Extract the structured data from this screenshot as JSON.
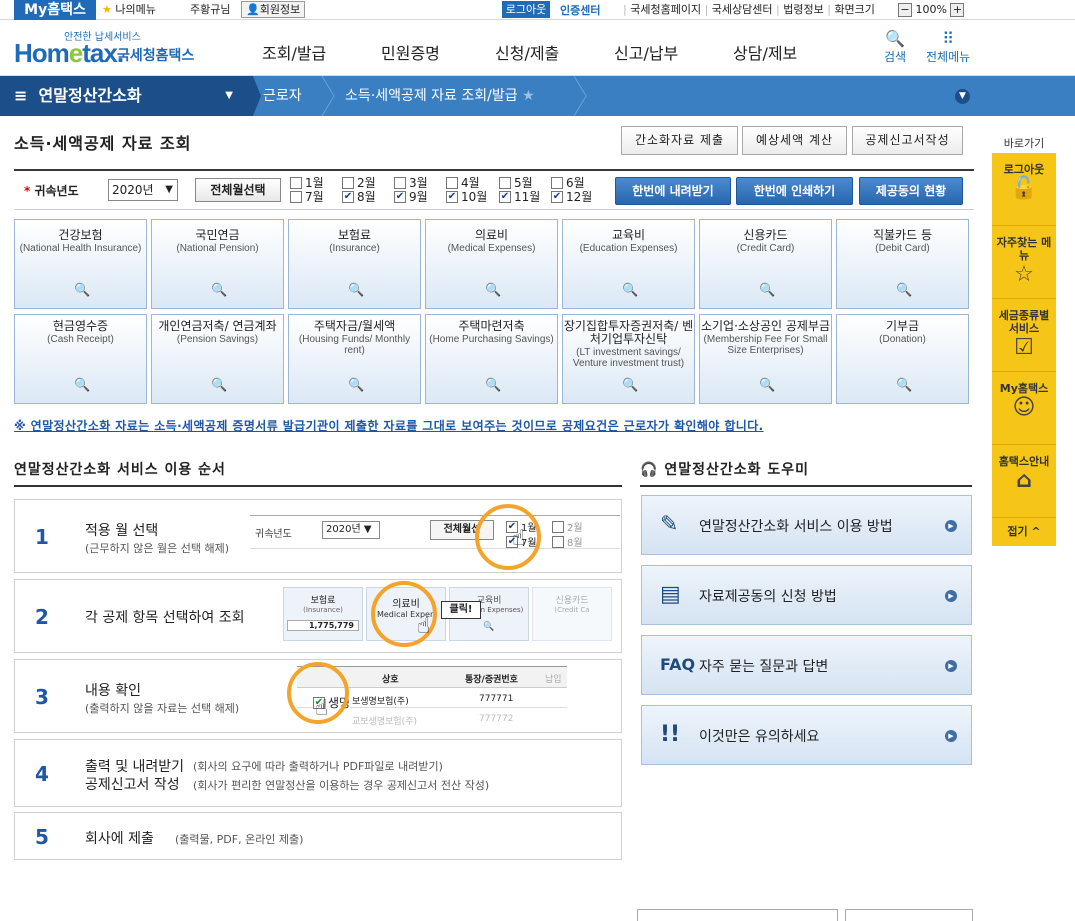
{
  "topbar": {
    "my_home": "My홈택스",
    "my_menu": "나의메뉴",
    "user_name": "주황규님",
    "member_info": "회원정보",
    "logout": "로그아웃",
    "cert_center": "인증센터",
    "links": [
      "국세청홈페이지",
      "국세상담센터",
      "법령정보",
      "화면크기"
    ],
    "zoom_minus": "−",
    "zoom": "100%",
    "zoom_plus": "+"
  },
  "header": {
    "logo_sub": "안전한 납세서비스",
    "logo_word_a": "Hom",
    "logo_word_e": "e",
    "logo_word_b": "tax.",
    "logo_kor": "국세청홈택스",
    "gnb": [
      "조회/발급",
      "민원증명",
      "신청/제출",
      "신고/납부",
      "상담/제보"
    ],
    "search": "검색",
    "all_menu": "전체메뉴"
  },
  "nav": {
    "main": "연말정산간소화",
    "crumb1": "근로자",
    "crumb2": "소득·세액공제 자료 조회/발급"
  },
  "page": {
    "title": "소득·세액공제 자료 조회",
    "top_buttons": [
      "간소화자료 제출",
      "예상세액 계산",
      "공제신고서작성"
    ]
  },
  "filter": {
    "label": "귀속년도",
    "year": "2020년",
    "select_all": "전체월선택",
    "months": [
      {
        "label": "1월",
        "checked": false
      },
      {
        "label": "2월",
        "checked": false
      },
      {
        "label": "3월",
        "checked": false
      },
      {
        "label": "4월",
        "checked": false
      },
      {
        "label": "5월",
        "checked": false
      },
      {
        "label": "6월",
        "checked": false
      },
      {
        "label": "7월",
        "checked": false
      },
      {
        "label": "8월",
        "checked": true
      },
      {
        "label": "9월",
        "checked": true
      },
      {
        "label": "10월",
        "checked": true
      },
      {
        "label": "11월",
        "checked": true
      },
      {
        "label": "12월",
        "checked": true
      }
    ],
    "download_all": "한번에 내려받기",
    "print_all": "한번에 인쇄하기",
    "provide_status": "제공동의 현황"
  },
  "tiles": [
    {
      "k": "건강보험",
      "e": "(National Health Insurance)"
    },
    {
      "k": "국민연금",
      "e": "(National Pension)"
    },
    {
      "k": "보험료",
      "e": "(Insurance)"
    },
    {
      "k": "의료비",
      "e": "(Medical Expenses)"
    },
    {
      "k": "교육비",
      "e": "(Education Expenses)"
    },
    {
      "k": "신용카드",
      "e": "(Credit Card)"
    },
    {
      "k": "직불카드 등",
      "e": "(Debit Card)"
    },
    {
      "k": "현금영수증",
      "e": "(Cash Receipt)"
    },
    {
      "k": "개인연금저축/ 연금계좌",
      "e": "(Pension Savings)"
    },
    {
      "k": "주택자금/월세액",
      "e": "(Housing Funds/ Monthly rent)"
    },
    {
      "k": "주택마련저축",
      "e": "(Home Purchasing Savings)"
    },
    {
      "k": "장기집합투자증권저축/ 벤처기업투자신탁",
      "e": "(LT investment savings/ Venture investment trust)"
    },
    {
      "k": "소기업·소상공인 공제부금",
      "e": "(Membership Fee For Small Size Enterprises)"
    },
    {
      "k": "기부금",
      "e": "(Donation)"
    }
  ],
  "notice": "※ 연말정산간소화 자료는 소득·세액공제 증명서류 발급기관이 제출한 자료를 그대로 보여주는 것이므로 공제요건은 근로자가 확인해야 합니다.",
  "steps_title": "연말정산간소화 서비스 이용 순서",
  "steps": [
    {
      "n": "1",
      "t": "적용 월 선택",
      "d": "(근무하지 않은 월은 선택 해제)"
    },
    {
      "n": "2",
      "t": "각 공제 항목 선택하여 조회",
      "d": ""
    },
    {
      "n": "3",
      "t": "내용 확인",
      "d": "(출력하지 않을 자료는 선택 해제)"
    },
    {
      "n": "4",
      "t": "출력 및 내려받기",
      "t2": "공제신고서 작성",
      "d": "(회사의 요구에 따라 출력하거나 PDF파일로 내려받기)",
      "d2": "(회사가 편리한 연말정산을 이용하는 경우 공제신고서 전산 작성)"
    },
    {
      "n": "5",
      "t": "회사에 제출",
      "d": "(출력물, PDF, 온라인 제출)"
    }
  ],
  "illus": {
    "s1_label": "귀속년도",
    "s1_year": "2020년",
    "s1_btn": "전체월선",
    "s1_m1": "1월",
    "s1_m2": "2월",
    "s1_m7": "7월",
    "s1_m8": "8월",
    "s2_a": "보험료",
    "s2_a_e": "(Insurance)",
    "s2_val": "1,775,779",
    "s2_b": "의료비",
    "s2_b_e": "Medical Expen",
    "s2_click": "클릭!",
    "s2_c": "교육비",
    "s2_c_e": "ducation Expenses)",
    "s2_d": "신용카드",
    "s2_d_e": "(Credit Ca",
    "s3_h1": "상호",
    "s3_h2": "통장/증권번호",
    "s3_h3": "납입",
    "s3_name": "생명",
    "s3_co": "보생명보험(주)",
    "s3_num": "777771",
    "s3_co2": "교보생명보험(주)",
    "s3_num2": "777772"
  },
  "help_title": "연말정산간소화 도우미",
  "help": [
    {
      "icon": "doc-pen-icon",
      "glyph": "✎",
      "t": "연말정산간소화 서비스 이용 방법"
    },
    {
      "icon": "doc-icon",
      "glyph": "▤",
      "t": "자료제공동의 신청 방법"
    },
    {
      "icon": "faq-icon",
      "glyph": "FAQ",
      "t": "자주 묻는 질문과 답변"
    },
    {
      "icon": "exclaim-icon",
      "glyph": "!!",
      "t": "이것만은 유의하세요"
    }
  ],
  "side": {
    "title": "바로가기",
    "items": [
      {
        "t": "로그아웃",
        "glyph": "🔓"
      },
      {
        "t": "자주찾는 메뉴",
        "glyph": "☆"
      },
      {
        "t": "세금종류별 서비스",
        "glyph": "☑"
      },
      {
        "t": "My홈택스",
        "glyph": "☺"
      },
      {
        "t": "홈택스안내",
        "glyph": "⌂"
      }
    ],
    "fold": "접기 ^"
  },
  "colors": {
    "primary": "#1f6bb7",
    "nav": "#3b7fc3",
    "nav_dark": "#1c4f8a",
    "side": "#f5c518",
    "highlight": "#f4a42a"
  }
}
